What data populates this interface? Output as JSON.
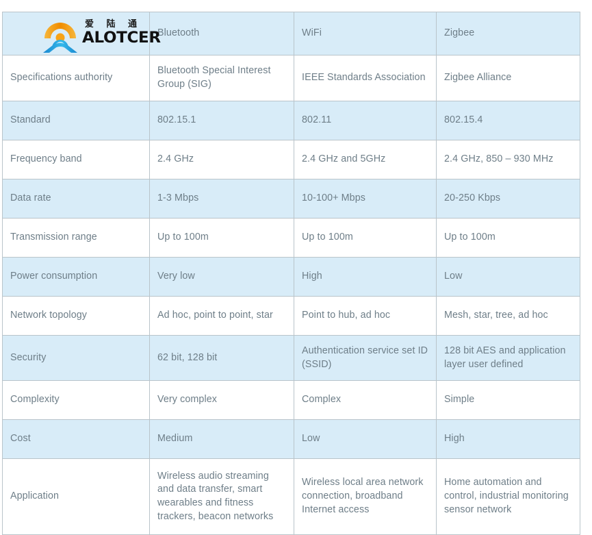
{
  "logo": {
    "name": "alotcer-logo",
    "chinese_text": "爱 陆 通",
    "brand_text": "ALOTCER",
    "mark_colors": {
      "arc_orange_light": "#f5a623",
      "arc_orange_dark": "#ef8200",
      "dot_orange": "#f7a11a",
      "mountain_blue_dark": "#1f8fd6",
      "mountain_blue_light": "#35b6e8"
    }
  },
  "theme": {
    "shaded_row_bg": "#d8ecf8",
    "plain_row_bg": "#ffffff",
    "border_color": "#b9c4ca",
    "text_color": "#6e7e88",
    "page_bg": "#ffffff"
  },
  "table": {
    "name": "wireless-protocol-comparison-table",
    "headers": [
      "",
      "Bluetooth",
      "WiFi",
      "Zigbee"
    ],
    "rows": [
      {
        "label": "Specifications authority",
        "bluetooth": "Bluetooth Special Interest Group (SIG)",
        "wifi": "IEEE Standards Association",
        "zigbee": "Zigbee Alliance",
        "shaded": false
      },
      {
        "label": "Standard",
        "bluetooth": "802.15.1",
        "wifi": "802.11",
        "zigbee": "802.15.4",
        "shaded": true
      },
      {
        "label": "Frequency band",
        "bluetooth": "2.4 GHz",
        "wifi": "2.4 GHz and 5GHz",
        "zigbee": "2.4 GHz, 850 – 930 MHz",
        "shaded": false
      },
      {
        "label": "Data rate",
        "bluetooth": "1-3 Mbps",
        "wifi": "10-100+ Mbps",
        "zigbee": "20-250 Kbps",
        "shaded": true
      },
      {
        "label": "Transmission range",
        "bluetooth": "Up to 100m",
        "wifi": "Up to 100m",
        "zigbee": "Up to 100m",
        "shaded": false
      },
      {
        "label": "Power consumption",
        "bluetooth": "Very low",
        "wifi": "High",
        "zigbee": "Low",
        "shaded": true
      },
      {
        "label": "Network topology",
        "bluetooth": "Ad hoc, point to point, star",
        "wifi": "Point to hub, ad hoc",
        "zigbee": "Mesh, star, tree, ad hoc",
        "shaded": false
      },
      {
        "label": "Security",
        "bluetooth": "62 bit, 128 bit",
        "wifi": "Authentication service set ID (SSID)",
        "zigbee": "128 bit AES and application layer user defined",
        "shaded": true
      },
      {
        "label": "Complexity",
        "bluetooth": "Very complex",
        "wifi": "Complex",
        "zigbee": "Simple",
        "shaded": false
      },
      {
        "label": "Cost",
        "bluetooth": "Medium",
        "wifi": "Low",
        "zigbee": "High",
        "shaded": true
      },
      {
        "label": "Application",
        "bluetooth": "Wireless audio streaming and data transfer,  smart wearables and fitness trackers, beacon networks",
        "wifi": "Wireless local area network connection, broadband Internet access",
        "zigbee": "Home automation and control, industrial monitoring sensor network",
        "shaded": false
      }
    ]
  }
}
